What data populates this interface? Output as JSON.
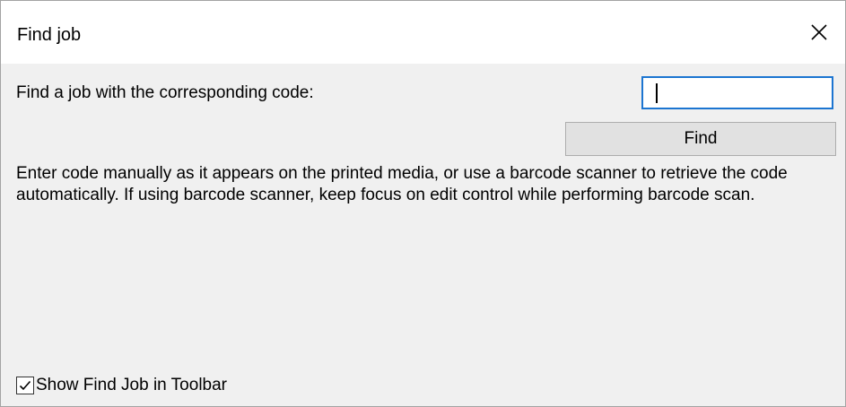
{
  "dialog": {
    "title": "Find job",
    "close_icon": "close-icon"
  },
  "form": {
    "prompt": "Find a job with the corresponding code:",
    "code_value": "",
    "find_label": "Find",
    "help_text": "Enter code manually as it appears on the printed media, or use a barcode scanner to retrieve the code automatically. If using barcode scanner, keep focus on edit control while performing barcode scan."
  },
  "options": {
    "show_in_toolbar_label": "Show Find Job in Toolbar",
    "show_in_toolbar_checked": true,
    "checkmark_icon": "checkmark-icon"
  },
  "colors": {
    "focus_border": "#1c75d1",
    "dialog_background": "#f0f0f0",
    "button_background": "#e1e1e1"
  }
}
